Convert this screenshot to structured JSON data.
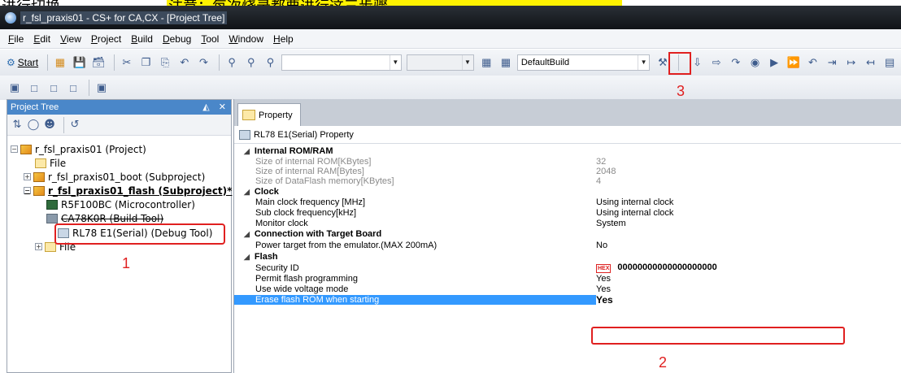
{
  "banner": {
    "text_left": "进行切换。",
    "text_highlight": "注意：每次烧录都要进行这三步骤。"
  },
  "window": {
    "title": "r_fsl_praxis01 - CS+ for CA,CX - [Project Tree]"
  },
  "menu": [
    "File",
    "Edit",
    "View",
    "Project",
    "Build",
    "Debug",
    "Tool",
    "Window",
    "Help"
  ],
  "toolbar": {
    "start_label": "Start",
    "build_config": "DefaultBuild"
  },
  "project_tree": {
    "title": "Project Tree",
    "pin": "❁",
    "close": "✕",
    "nodes": [
      {
        "label": "r_fsl_praxis01 (Project)"
      },
      {
        "label": "File"
      },
      {
        "label": "r_fsl_praxis01_boot (Subproject)"
      },
      {
        "label": "r_fsl_praxis01_flash (Subproject)*"
      },
      {
        "label": "R5F100BC (Microcontroller)"
      },
      {
        "label": "CA78K0R (Build Tool)"
      },
      {
        "label": "RL78 E1(Serial) (Debug Tool)"
      },
      {
        "label": "File"
      }
    ]
  },
  "property": {
    "tab_label": "Property",
    "header": "RL78 E1(Serial) Property",
    "rows": [
      {
        "name": "Internal ROM/RAM",
        "value": ""
      },
      {
        "name": "Size of internal ROM[KBytes]",
        "value": "32"
      },
      {
        "name": "Size of internal RAM[Bytes]",
        "value": "2048"
      },
      {
        "name": "Size of DataFlash memory[KBytes]",
        "value": "4"
      },
      {
        "name": "Clock",
        "value": ""
      },
      {
        "name": "Main clock frequency [MHz]",
        "value": "Using internal clock"
      },
      {
        "name": "Sub clock frequency[kHz]",
        "value": "Using internal clock"
      },
      {
        "name": "Monitor clock",
        "value": "System"
      },
      {
        "name": "Connection with Target Board",
        "value": ""
      },
      {
        "name": "Power target from the emulator.(MAX 200mA)",
        "value": "No"
      },
      {
        "name": "Flash",
        "value": ""
      },
      {
        "name": "Security ID",
        "value": "00000000000000000000",
        "badge": "HEX"
      },
      {
        "name": "Permit flash programming",
        "value": "Yes"
      },
      {
        "name": "Use wide voltage mode",
        "value": "Yes"
      },
      {
        "name": "Erase flash ROM when starting",
        "value": "Yes"
      }
    ]
  },
  "annotations": {
    "n1": "1",
    "n2": "2",
    "n3": "3"
  },
  "colors": {
    "accent": "#4a87c9",
    "annotation_red": "#e02020",
    "selection": "#3399ff"
  }
}
